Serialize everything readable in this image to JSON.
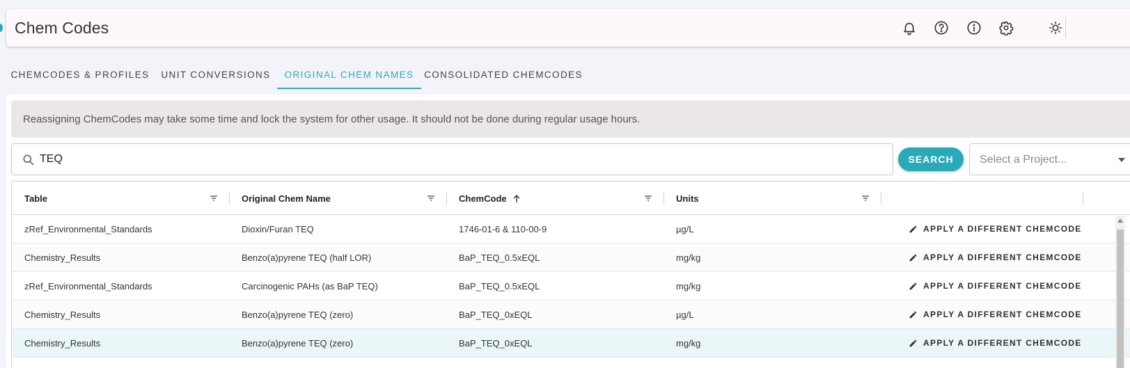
{
  "app": {
    "title": "Chem Codes"
  },
  "header_icons": [
    "bell-icon",
    "help-icon",
    "info-icon",
    "gear-icon",
    "sun-icon"
  ],
  "tabs": [
    {
      "label": "CHEMCODES & PROFILES",
      "active": false
    },
    {
      "label": "UNIT CONVERSIONS",
      "active": false
    },
    {
      "label": "ORIGINAL CHEM NAMES",
      "active": true
    },
    {
      "label": "CONSOLIDATED CHEMCODES",
      "active": false
    }
  ],
  "notice": "Reassigning ChemCodes may take some time and lock the system for other usage. It should not be done during regular usage hours.",
  "search": {
    "value": "TEQ",
    "button_label": "SEARCH"
  },
  "project_select": {
    "placeholder": "Select a Project..."
  },
  "table": {
    "columns": [
      "Table",
      "Original Chem Name",
      "ChemCode",
      "Units",
      ""
    ],
    "sort": {
      "column": "ChemCode",
      "direction": "asc"
    },
    "action_label": "APPLY A DIFFERENT CHEMCODE",
    "rows": [
      {
        "table": "zRef_Environmental_Standards",
        "name": "Dioxin/Furan TEQ",
        "chemcode": "1746-01-6 & 110-00-9",
        "units": "µg/L"
      },
      {
        "table": "Chemistry_Results",
        "name": "Benzo(a)pyrene TEQ (half LOR)",
        "chemcode": "BaP_TEQ_0.5xEQL",
        "units": "mg/kg"
      },
      {
        "table": "zRef_Environmental_Standards",
        "name": "Carcinogenic PAHs (as BaP TEQ)",
        "chemcode": "BaP_TEQ_0.5xEQL",
        "units": "mg/kg"
      },
      {
        "table": "Chemistry_Results",
        "name": "Benzo(a)pyrene TEQ (zero)",
        "chemcode": "BaP_TEQ_0xEQL",
        "units": "µg/L"
      },
      {
        "table": "Chemistry_Results",
        "name": "Benzo(a)pyrene TEQ (zero)",
        "chemcode": "BaP_TEQ_0xEQL",
        "units": "mg/kg"
      }
    ]
  },
  "colors": {
    "accent": "#2aa9b9",
    "notice_bg": "#ebe6ea",
    "highlight_row": "#eaf6f7"
  }
}
